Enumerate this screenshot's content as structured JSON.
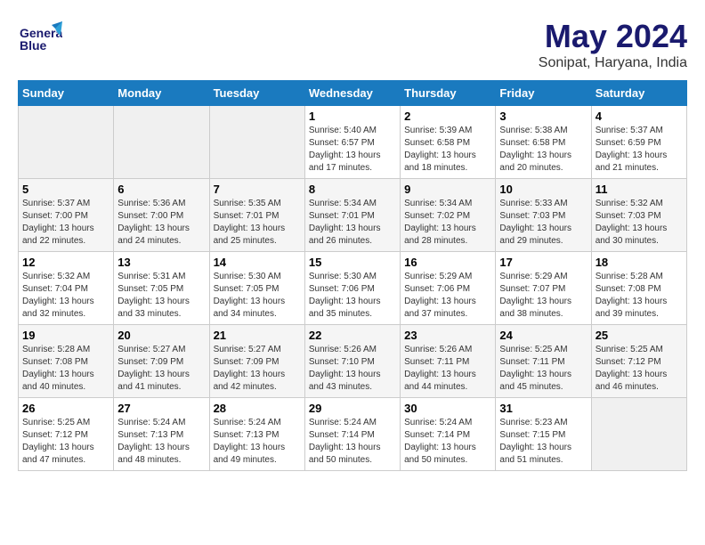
{
  "logo": {
    "line1": "General",
    "line2": "Blue"
  },
  "title": "May 2024",
  "location": "Sonipat, Haryana, India",
  "days_of_week": [
    "Sunday",
    "Monday",
    "Tuesday",
    "Wednesday",
    "Thursday",
    "Friday",
    "Saturday"
  ],
  "weeks": [
    [
      {
        "day": "",
        "info": ""
      },
      {
        "day": "",
        "info": ""
      },
      {
        "day": "",
        "info": ""
      },
      {
        "day": "1",
        "info": "Sunrise: 5:40 AM\nSunset: 6:57 PM\nDaylight: 13 hours and 17 minutes."
      },
      {
        "day": "2",
        "info": "Sunrise: 5:39 AM\nSunset: 6:58 PM\nDaylight: 13 hours and 18 minutes."
      },
      {
        "day": "3",
        "info": "Sunrise: 5:38 AM\nSunset: 6:58 PM\nDaylight: 13 hours and 20 minutes."
      },
      {
        "day": "4",
        "info": "Sunrise: 5:37 AM\nSunset: 6:59 PM\nDaylight: 13 hours and 21 minutes."
      }
    ],
    [
      {
        "day": "5",
        "info": "Sunrise: 5:37 AM\nSunset: 7:00 PM\nDaylight: 13 hours and 22 minutes."
      },
      {
        "day": "6",
        "info": "Sunrise: 5:36 AM\nSunset: 7:00 PM\nDaylight: 13 hours and 24 minutes."
      },
      {
        "day": "7",
        "info": "Sunrise: 5:35 AM\nSunset: 7:01 PM\nDaylight: 13 hours and 25 minutes."
      },
      {
        "day": "8",
        "info": "Sunrise: 5:34 AM\nSunset: 7:01 PM\nDaylight: 13 hours and 26 minutes."
      },
      {
        "day": "9",
        "info": "Sunrise: 5:34 AM\nSunset: 7:02 PM\nDaylight: 13 hours and 28 minutes."
      },
      {
        "day": "10",
        "info": "Sunrise: 5:33 AM\nSunset: 7:03 PM\nDaylight: 13 hours and 29 minutes."
      },
      {
        "day": "11",
        "info": "Sunrise: 5:32 AM\nSunset: 7:03 PM\nDaylight: 13 hours and 30 minutes."
      }
    ],
    [
      {
        "day": "12",
        "info": "Sunrise: 5:32 AM\nSunset: 7:04 PM\nDaylight: 13 hours and 32 minutes."
      },
      {
        "day": "13",
        "info": "Sunrise: 5:31 AM\nSunset: 7:05 PM\nDaylight: 13 hours and 33 minutes."
      },
      {
        "day": "14",
        "info": "Sunrise: 5:30 AM\nSunset: 7:05 PM\nDaylight: 13 hours and 34 minutes."
      },
      {
        "day": "15",
        "info": "Sunrise: 5:30 AM\nSunset: 7:06 PM\nDaylight: 13 hours and 35 minutes."
      },
      {
        "day": "16",
        "info": "Sunrise: 5:29 AM\nSunset: 7:06 PM\nDaylight: 13 hours and 37 minutes."
      },
      {
        "day": "17",
        "info": "Sunrise: 5:29 AM\nSunset: 7:07 PM\nDaylight: 13 hours and 38 minutes."
      },
      {
        "day": "18",
        "info": "Sunrise: 5:28 AM\nSunset: 7:08 PM\nDaylight: 13 hours and 39 minutes."
      }
    ],
    [
      {
        "day": "19",
        "info": "Sunrise: 5:28 AM\nSunset: 7:08 PM\nDaylight: 13 hours and 40 minutes."
      },
      {
        "day": "20",
        "info": "Sunrise: 5:27 AM\nSunset: 7:09 PM\nDaylight: 13 hours and 41 minutes."
      },
      {
        "day": "21",
        "info": "Sunrise: 5:27 AM\nSunset: 7:09 PM\nDaylight: 13 hours and 42 minutes."
      },
      {
        "day": "22",
        "info": "Sunrise: 5:26 AM\nSunset: 7:10 PM\nDaylight: 13 hours and 43 minutes."
      },
      {
        "day": "23",
        "info": "Sunrise: 5:26 AM\nSunset: 7:11 PM\nDaylight: 13 hours and 44 minutes."
      },
      {
        "day": "24",
        "info": "Sunrise: 5:25 AM\nSunset: 7:11 PM\nDaylight: 13 hours and 45 minutes."
      },
      {
        "day": "25",
        "info": "Sunrise: 5:25 AM\nSunset: 7:12 PM\nDaylight: 13 hours and 46 minutes."
      }
    ],
    [
      {
        "day": "26",
        "info": "Sunrise: 5:25 AM\nSunset: 7:12 PM\nDaylight: 13 hours and 47 minutes."
      },
      {
        "day": "27",
        "info": "Sunrise: 5:24 AM\nSunset: 7:13 PM\nDaylight: 13 hours and 48 minutes."
      },
      {
        "day": "28",
        "info": "Sunrise: 5:24 AM\nSunset: 7:13 PM\nDaylight: 13 hours and 49 minutes."
      },
      {
        "day": "29",
        "info": "Sunrise: 5:24 AM\nSunset: 7:14 PM\nDaylight: 13 hours and 50 minutes."
      },
      {
        "day": "30",
        "info": "Sunrise: 5:24 AM\nSunset: 7:14 PM\nDaylight: 13 hours and 50 minutes."
      },
      {
        "day": "31",
        "info": "Sunrise: 5:23 AM\nSunset: 7:15 PM\nDaylight: 13 hours and 51 minutes."
      },
      {
        "day": "",
        "info": ""
      }
    ]
  ]
}
